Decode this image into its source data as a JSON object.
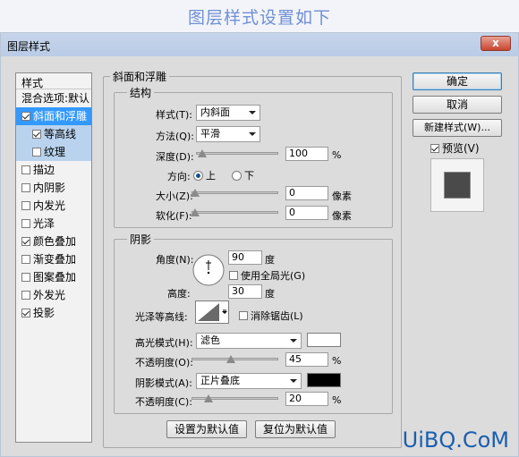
{
  "banner": {
    "text": "图层样式设置如下"
  },
  "dialog": {
    "title": "图层样式",
    "close": "x"
  },
  "sidebar": {
    "header": "样式",
    "blend": "混合选项:默认",
    "items": [
      {
        "label": "斜面和浮雕",
        "checked": true
      },
      {
        "label": "等高线",
        "checked": true
      },
      {
        "label": "纹理",
        "checked": false
      },
      {
        "label": "描边",
        "checked": false
      },
      {
        "label": "内阴影",
        "checked": false
      },
      {
        "label": "内发光",
        "checked": false
      },
      {
        "label": "光泽",
        "checked": false
      },
      {
        "label": "颜色叠加",
        "checked": true
      },
      {
        "label": "渐变叠加",
        "checked": false
      },
      {
        "label": "图案叠加",
        "checked": false
      },
      {
        "label": "外发光",
        "checked": false
      },
      {
        "label": "投影",
        "checked": true
      }
    ]
  },
  "bevel": {
    "title": "斜面和浮雕",
    "structure": {
      "title": "结构",
      "style_label": "样式(T):",
      "style_value": "内斜面",
      "method_label": "方法(Q):",
      "method_value": "平滑",
      "depth_label": "深度(D):",
      "depth_value": "100",
      "depth_unit": "%",
      "direction_label": "方向:",
      "dir_up": "上",
      "dir_down": "下",
      "size_label": "大小(Z):",
      "size_value": "0",
      "size_unit": "像素",
      "soften_label": "软化(F):",
      "soften_value": "0",
      "soften_unit": "像素"
    },
    "shading": {
      "title": "阴影",
      "angle_label": "角度(N):",
      "angle_value": "90",
      "angle_unit": "度",
      "global_light": "使用全局光(G)",
      "altitude_label": "高度:",
      "altitude_value": "30",
      "altitude_unit": "度",
      "gloss_label": "光泽等高线:",
      "antialias": "消除锯齿(L)",
      "highlight_label": "高光模式(H):",
      "highlight_mode": "滤色",
      "highlight_color": "#ffffff",
      "hl_opacity_label": "不透明度(O):",
      "hl_opacity_value": "45",
      "hl_opacity_unit": "%",
      "shadow_label": "阴影模式(A):",
      "shadow_mode": "正片叠底",
      "shadow_color": "#000000",
      "sh_opacity_label": "不透明度(C):",
      "sh_opacity_value": "20",
      "sh_opacity_unit": "%"
    },
    "make_default": "设置为默认值",
    "reset_default": "复位为默认值"
  },
  "buttons": {
    "ok": "确定",
    "cancel": "取消",
    "new_style": "新建样式(W)...",
    "preview": "预览(V)"
  },
  "watermark": "UiBQ.CoM"
}
